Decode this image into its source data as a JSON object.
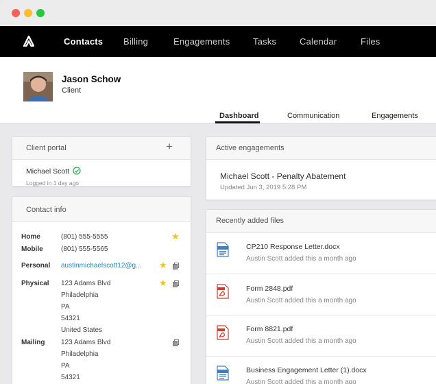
{
  "nav": {
    "items": [
      {
        "label": "Contacts",
        "active": true
      },
      {
        "label": "Billing",
        "active": false
      },
      {
        "label": "Engagements",
        "active": false
      },
      {
        "label": "Tasks",
        "active": false
      },
      {
        "label": "Calendar",
        "active": false
      },
      {
        "label": "Files",
        "active": false
      }
    ]
  },
  "profile": {
    "name": "Jason Schow",
    "role": "Client",
    "tabs": [
      {
        "label": "Dashboard",
        "active": true
      },
      {
        "label": "Communication",
        "active": false
      },
      {
        "label": "Engagements",
        "active": false
      }
    ]
  },
  "client_portal": {
    "title": "Client portal",
    "user": "Michael Scott",
    "last_login": "Logged in 1 day ago"
  },
  "contact_info": {
    "title": "Contact info",
    "home_label": "Home",
    "home_phone": "(801) 555-5555",
    "mobile_label": "Mobile",
    "mobile_phone": "(801) 555-5565",
    "personal_label": "Personal",
    "email": "austinmichaelscott12@g...",
    "physical_label": "Physical",
    "physical": [
      "123 Adams Blvd",
      "Philadelphia",
      "PA",
      "54321",
      "United States"
    ],
    "mailing_label": "Mailing",
    "mailing": [
      "123 Adams Blvd",
      "Philadelphia",
      "PA",
      "54321"
    ]
  },
  "active_engagements": {
    "title": "Active engagements",
    "item_title": "Michael Scott - Penalty Abatement",
    "item_updated": "Updated Jun 3, 2019 5:28 PM"
  },
  "recent_files": {
    "title": "Recently added files",
    "files": [
      {
        "name": "CP210 Response Letter.docx",
        "meta": "Austin Scott added this a month ago",
        "icon": "word-doc-icon"
      },
      {
        "name": "Form 2848.pdf",
        "meta": "Austin Scott added this a month ago",
        "icon": "pdf-icon"
      },
      {
        "name": "Form 8821.pdf",
        "meta": "Austin Scott added this a month ago",
        "icon": "pdf-icon"
      },
      {
        "name": "Business Engagement Letter (1).docx",
        "meta": "Austin Scott added this a month ago",
        "icon": "word-doc-icon"
      }
    ]
  },
  "colors": {
    "accent": "#1a8ad4",
    "star": "#f1c40f",
    "pdf": "#d33a2c",
    "check": "#2eaa4b"
  }
}
